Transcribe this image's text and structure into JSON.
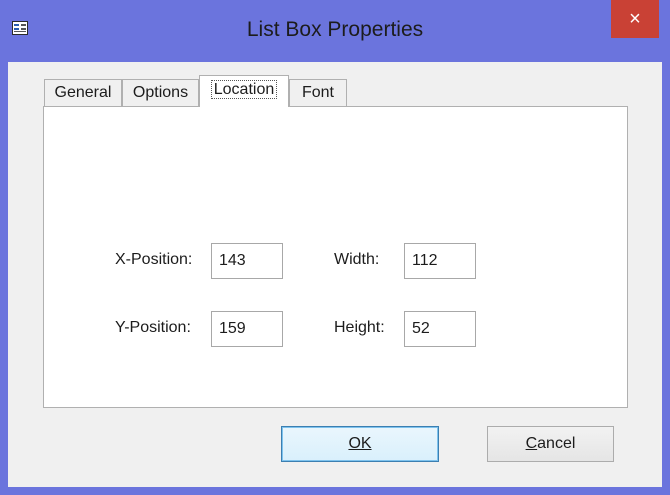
{
  "window": {
    "title": "List Box Properties",
    "close_glyph": "×",
    "app_icon": "properties-dialog-icon"
  },
  "tabs": [
    {
      "label": "General",
      "active": false
    },
    {
      "label": "Options",
      "active": false
    },
    {
      "label": "Location",
      "active": true
    },
    {
      "label": "Font",
      "active": false
    }
  ],
  "location": {
    "x_label": "X-Position:",
    "x_value": "143",
    "y_label": "Y-Position:",
    "y_value": "159",
    "width_label": "Width:",
    "width_value": "112",
    "height_label": "Height:",
    "height_value": "52"
  },
  "buttons": {
    "ok_label": "OK",
    "cancel_label": "Cancel"
  },
  "colors": {
    "frame": "#6b74dd",
    "close": "#c94135",
    "default_button_border": "#3c7fb1"
  }
}
